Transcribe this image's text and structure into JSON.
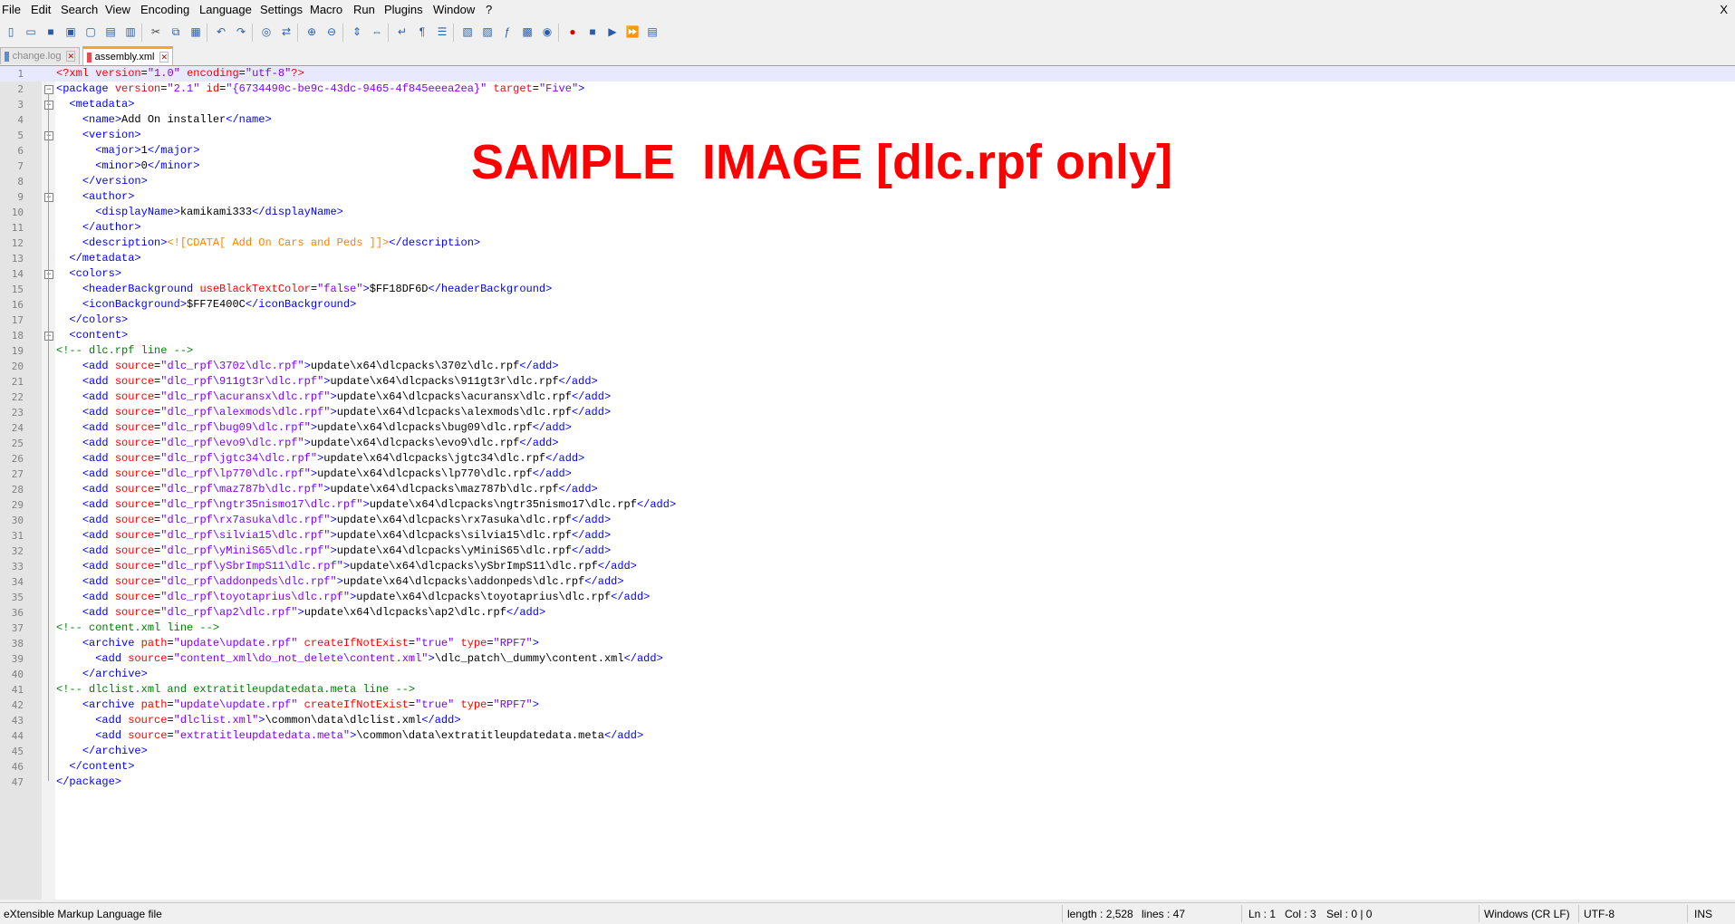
{
  "menu": {
    "items": [
      "File",
      "Edit",
      "Search",
      "View",
      "Encoding",
      "Language",
      "Settings",
      "Macro",
      "Run",
      "Plugins",
      "Window",
      "?"
    ],
    "close_label": "X"
  },
  "toolbar": {
    "icons": [
      "new-file-icon",
      "open-file-icon",
      "save-icon",
      "save-all-icon",
      "close-icon",
      "close-all-icon",
      "print-icon",
      "cut-icon",
      "copy-icon",
      "paste-icon",
      "undo-icon",
      "redo-icon",
      "find-icon",
      "replace-icon",
      "zoom-in-icon",
      "zoom-out-icon",
      "sync-vertical-icon",
      "sync-horizontal-icon",
      "word-wrap-icon",
      "show-all-chars-icon",
      "indent-guide-icon",
      "lang-define-icon",
      "doc-map-icon",
      "function-list-icon",
      "folder-workspace-icon",
      "monitoring-icon",
      "record-macro-icon",
      "stop-macro-icon",
      "play-macro-icon",
      "run-macro-multiple-icon",
      "save-macro-icon"
    ]
  },
  "tabs": [
    {
      "label": "change.log",
      "active": false
    },
    {
      "label": "assembly.xml",
      "active": true
    }
  ],
  "editor": {
    "current_line": 1,
    "lines": [
      [
        [
          "t-pi",
          "<?xml "
        ],
        [
          "t-attr",
          "version"
        ],
        [
          "t-tx",
          "="
        ],
        [
          "t-val",
          "\"1.0\""
        ],
        [
          "t-tx",
          " "
        ],
        [
          "t-attr",
          "encoding"
        ],
        [
          "t-tx",
          "="
        ],
        [
          "t-val",
          "\"utf-8\""
        ],
        [
          "t-pi",
          "?>"
        ]
      ],
      [
        [
          "t-tag",
          "<package "
        ],
        [
          "t-attr",
          "version"
        ],
        [
          "t-tx",
          "="
        ],
        [
          "t-val",
          "\"2.1\""
        ],
        [
          "t-tx",
          " "
        ],
        [
          "t-attr",
          "id"
        ],
        [
          "t-tx",
          "="
        ],
        [
          "t-val",
          "\"{6734490c-be9c-43dc-9465-4f845eeea2ea}\""
        ],
        [
          "t-tx",
          " "
        ],
        [
          "t-attr",
          "target"
        ],
        [
          "t-tx",
          "="
        ],
        [
          "t-val",
          "\"Five\""
        ],
        [
          "t-tag",
          ">"
        ]
      ],
      [
        [
          "t-tx",
          "  "
        ],
        [
          "t-tag",
          "<metadata>"
        ]
      ],
      [
        [
          "t-tx",
          "    "
        ],
        [
          "t-tag",
          "<name>"
        ],
        [
          "t-tx",
          "Add On installer"
        ],
        [
          "t-tag",
          "</name>"
        ]
      ],
      [
        [
          "t-tx",
          "    "
        ],
        [
          "t-tag",
          "<version>"
        ]
      ],
      [
        [
          "t-tx",
          "      "
        ],
        [
          "t-tag",
          "<major>"
        ],
        [
          "t-tx",
          "1"
        ],
        [
          "t-tag",
          "</major>"
        ]
      ],
      [
        [
          "t-tx",
          "      "
        ],
        [
          "t-tag",
          "<minor>"
        ],
        [
          "t-tx",
          "0"
        ],
        [
          "t-tag",
          "</minor>"
        ]
      ],
      [
        [
          "t-tx",
          "    "
        ],
        [
          "t-tag",
          "</version>"
        ]
      ],
      [
        [
          "t-tx",
          "    "
        ],
        [
          "t-tag",
          "<author>"
        ]
      ],
      [
        [
          "t-tx",
          "      "
        ],
        [
          "t-tag",
          "<displayName>"
        ],
        [
          "t-tx",
          "kamikami333"
        ],
        [
          "t-tag",
          "</displayName>"
        ]
      ],
      [
        [
          "t-tx",
          "    "
        ],
        [
          "t-tag",
          "</author>"
        ]
      ],
      [
        [
          "t-tx",
          "    "
        ],
        [
          "t-tag",
          "<description>"
        ],
        [
          "t-cd",
          "<![CDATA[ Add On Cars and Peds ]]>"
        ],
        [
          "t-tag",
          "</description>"
        ]
      ],
      [
        [
          "t-tx",
          "  "
        ],
        [
          "t-tag",
          "</metadata>"
        ]
      ],
      [
        [
          "t-tx",
          "  "
        ],
        [
          "t-tag",
          "<colors>"
        ]
      ],
      [
        [
          "t-tx",
          "    "
        ],
        [
          "t-tag",
          "<headerBackground "
        ],
        [
          "t-attr",
          "useBlackTextColor"
        ],
        [
          "t-tx",
          "="
        ],
        [
          "t-val",
          "\"false\""
        ],
        [
          "t-tag",
          ">"
        ],
        [
          "t-tx",
          "$FF18DF6D"
        ],
        [
          "t-tag",
          "</headerBackground>"
        ]
      ],
      [
        [
          "t-tx",
          "    "
        ],
        [
          "t-tag",
          "<iconBackground>"
        ],
        [
          "t-tx",
          "$FF7E400C"
        ],
        [
          "t-tag",
          "</iconBackground>"
        ]
      ],
      [
        [
          "t-tx",
          "  "
        ],
        [
          "t-tag",
          "</colors>"
        ]
      ],
      [
        [
          "t-tx",
          "  "
        ],
        [
          "t-tag",
          "<content>"
        ]
      ],
      [
        [
          "t-cm",
          "<!-- dlc.rpf line -->"
        ]
      ],
      [
        [
          "t-tx",
          "    "
        ],
        [
          "t-tag",
          "<add "
        ],
        [
          "t-attr",
          "source"
        ],
        [
          "t-tx",
          "="
        ],
        [
          "t-val",
          "\"dlc_rpf\\370z\\dlc.rpf\""
        ],
        [
          "t-tag",
          ">"
        ],
        [
          "t-tx",
          "update\\x64\\dlcpacks\\370z\\dlc.rpf"
        ],
        [
          "t-tag",
          "</add>"
        ]
      ],
      [
        [
          "t-tx",
          "    "
        ],
        [
          "t-tag",
          "<add "
        ],
        [
          "t-attr",
          "source"
        ],
        [
          "t-tx",
          "="
        ],
        [
          "t-val",
          "\"dlc_rpf\\911gt3r\\dlc.rpf\""
        ],
        [
          "t-tag",
          ">"
        ],
        [
          "t-tx",
          "update\\x64\\dlcpacks\\911gt3r\\dlc.rpf"
        ],
        [
          "t-tag",
          "</add>"
        ]
      ],
      [
        [
          "t-tx",
          "    "
        ],
        [
          "t-tag",
          "<add "
        ],
        [
          "t-attr",
          "source"
        ],
        [
          "t-tx",
          "="
        ],
        [
          "t-val",
          "\"dlc_rpf\\acuransx\\dlc.rpf\""
        ],
        [
          "t-tag",
          ">"
        ],
        [
          "t-tx",
          "update\\x64\\dlcpacks\\acuransx\\dlc.rpf"
        ],
        [
          "t-tag",
          "</add>"
        ]
      ],
      [
        [
          "t-tx",
          "    "
        ],
        [
          "t-tag",
          "<add "
        ],
        [
          "t-attr",
          "source"
        ],
        [
          "t-tx",
          "="
        ],
        [
          "t-val",
          "\"dlc_rpf\\alexmods\\dlc.rpf\""
        ],
        [
          "t-tag",
          ">"
        ],
        [
          "t-tx",
          "update\\x64\\dlcpacks\\alexmods\\dlc.rpf"
        ],
        [
          "t-tag",
          "</add>"
        ]
      ],
      [
        [
          "t-tx",
          "    "
        ],
        [
          "t-tag",
          "<add "
        ],
        [
          "t-attr",
          "source"
        ],
        [
          "t-tx",
          "="
        ],
        [
          "t-val",
          "\"dlc_rpf\\bug09\\dlc.rpf\""
        ],
        [
          "t-tag",
          ">"
        ],
        [
          "t-tx",
          "update\\x64\\dlcpacks\\bug09\\dlc.rpf"
        ],
        [
          "t-tag",
          "</add>"
        ]
      ],
      [
        [
          "t-tx",
          "    "
        ],
        [
          "t-tag",
          "<add "
        ],
        [
          "t-attr",
          "source"
        ],
        [
          "t-tx",
          "="
        ],
        [
          "t-val",
          "\"dlc_rpf\\evo9\\dlc.rpf\""
        ],
        [
          "t-tag",
          ">"
        ],
        [
          "t-tx",
          "update\\x64\\dlcpacks\\evo9\\dlc.rpf"
        ],
        [
          "t-tag",
          "</add>"
        ]
      ],
      [
        [
          "t-tx",
          "    "
        ],
        [
          "t-tag",
          "<add "
        ],
        [
          "t-attr",
          "source"
        ],
        [
          "t-tx",
          "="
        ],
        [
          "t-val",
          "\"dlc_rpf\\jgtc34\\dlc.rpf\""
        ],
        [
          "t-tag",
          ">"
        ],
        [
          "t-tx",
          "update\\x64\\dlcpacks\\jgtc34\\dlc.rpf"
        ],
        [
          "t-tag",
          "</add>"
        ]
      ],
      [
        [
          "t-tx",
          "    "
        ],
        [
          "t-tag",
          "<add "
        ],
        [
          "t-attr",
          "source"
        ],
        [
          "t-tx",
          "="
        ],
        [
          "t-val",
          "\"dlc_rpf\\lp770\\dlc.rpf\""
        ],
        [
          "t-tag",
          ">"
        ],
        [
          "t-tx",
          "update\\x64\\dlcpacks\\lp770\\dlc.rpf"
        ],
        [
          "t-tag",
          "</add>"
        ]
      ],
      [
        [
          "t-tx",
          "    "
        ],
        [
          "t-tag",
          "<add "
        ],
        [
          "t-attr",
          "source"
        ],
        [
          "t-tx",
          "="
        ],
        [
          "t-val",
          "\"dlc_rpf\\maz787b\\dlc.rpf\""
        ],
        [
          "t-tag",
          ">"
        ],
        [
          "t-tx",
          "update\\x64\\dlcpacks\\maz787b\\dlc.rpf"
        ],
        [
          "t-tag",
          "</add>"
        ]
      ],
      [
        [
          "t-tx",
          "    "
        ],
        [
          "t-tag",
          "<add "
        ],
        [
          "t-attr",
          "source"
        ],
        [
          "t-tx",
          "="
        ],
        [
          "t-val",
          "\"dlc_rpf\\ngtr35nismo17\\dlc.rpf\""
        ],
        [
          "t-tag",
          ">"
        ],
        [
          "t-tx",
          "update\\x64\\dlcpacks\\ngtr35nismo17\\dlc.rpf"
        ],
        [
          "t-tag",
          "</add>"
        ]
      ],
      [
        [
          "t-tx",
          "    "
        ],
        [
          "t-tag",
          "<add "
        ],
        [
          "t-attr",
          "source"
        ],
        [
          "t-tx",
          "="
        ],
        [
          "t-val",
          "\"dlc_rpf\\rx7asuka\\dlc.rpf\""
        ],
        [
          "t-tag",
          ">"
        ],
        [
          "t-tx",
          "update\\x64\\dlcpacks\\rx7asuka\\dlc.rpf"
        ],
        [
          "t-tag",
          "</add>"
        ]
      ],
      [
        [
          "t-tx",
          "    "
        ],
        [
          "t-tag",
          "<add "
        ],
        [
          "t-attr",
          "source"
        ],
        [
          "t-tx",
          "="
        ],
        [
          "t-val",
          "\"dlc_rpf\\silvia15\\dlc.rpf\""
        ],
        [
          "t-tag",
          ">"
        ],
        [
          "t-tx",
          "update\\x64\\dlcpacks\\silvia15\\dlc.rpf"
        ],
        [
          "t-tag",
          "</add>"
        ]
      ],
      [
        [
          "t-tx",
          "    "
        ],
        [
          "t-tag",
          "<add "
        ],
        [
          "t-attr",
          "source"
        ],
        [
          "t-tx",
          "="
        ],
        [
          "t-val",
          "\"dlc_rpf\\yMiniS65\\dlc.rpf\""
        ],
        [
          "t-tag",
          ">"
        ],
        [
          "t-tx",
          "update\\x64\\dlcpacks\\yMiniS65\\dlc.rpf"
        ],
        [
          "t-tag",
          "</add>"
        ]
      ],
      [
        [
          "t-tx",
          "    "
        ],
        [
          "t-tag",
          "<add "
        ],
        [
          "t-attr",
          "source"
        ],
        [
          "t-tx",
          "="
        ],
        [
          "t-val",
          "\"dlc_rpf\\ySbrImpS11\\dlc.rpf\""
        ],
        [
          "t-tag",
          ">"
        ],
        [
          "t-tx",
          "update\\x64\\dlcpacks\\ySbrImpS11\\dlc.rpf"
        ],
        [
          "t-tag",
          "</add>"
        ]
      ],
      [
        [
          "t-tx",
          "    "
        ],
        [
          "t-tag",
          "<add "
        ],
        [
          "t-attr",
          "source"
        ],
        [
          "t-tx",
          "="
        ],
        [
          "t-val",
          "\"dlc_rpf\\addonpeds\\dlc.rpf\""
        ],
        [
          "t-tag",
          ">"
        ],
        [
          "t-tx",
          "update\\x64\\dlcpacks\\addonpeds\\dlc.rpf"
        ],
        [
          "t-tag",
          "</add>"
        ]
      ],
      [
        [
          "t-tx",
          "    "
        ],
        [
          "t-tag",
          "<add "
        ],
        [
          "t-attr",
          "source"
        ],
        [
          "t-tx",
          "="
        ],
        [
          "t-val",
          "\"dlc_rpf\\toyotaprius\\dlc.rpf\""
        ],
        [
          "t-tag",
          ">"
        ],
        [
          "t-tx",
          "update\\x64\\dlcpacks\\toyotaprius\\dlc.rpf"
        ],
        [
          "t-tag",
          "</add>"
        ]
      ],
      [
        [
          "t-tx",
          "    "
        ],
        [
          "t-tag",
          "<add "
        ],
        [
          "t-attr",
          "source"
        ],
        [
          "t-tx",
          "="
        ],
        [
          "t-val",
          "\"dlc_rpf\\ap2\\dlc.rpf\""
        ],
        [
          "t-tag",
          ">"
        ],
        [
          "t-tx",
          "update\\x64\\dlcpacks\\ap2\\dlc.rpf"
        ],
        [
          "t-tag",
          "</add>"
        ]
      ],
      [
        [
          "t-cm",
          "<!-- content.xml line -->"
        ]
      ],
      [
        [
          "t-tx",
          "    "
        ],
        [
          "t-tag",
          "<archive "
        ],
        [
          "t-attr",
          "path"
        ],
        [
          "t-tx",
          "="
        ],
        [
          "t-val",
          "\"update\\update.rpf\""
        ],
        [
          "t-tx",
          " "
        ],
        [
          "t-attr",
          "createIfNotExist"
        ],
        [
          "t-tx",
          "="
        ],
        [
          "t-val",
          "\"true\""
        ],
        [
          "t-tx",
          " "
        ],
        [
          "t-attr",
          "type"
        ],
        [
          "t-tx",
          "="
        ],
        [
          "t-val",
          "\"RPF7\""
        ],
        [
          "t-tag",
          ">"
        ]
      ],
      [
        [
          "t-tx",
          "      "
        ],
        [
          "t-tag",
          "<add "
        ],
        [
          "t-attr",
          "source"
        ],
        [
          "t-tx",
          "="
        ],
        [
          "t-val",
          "\"content_xml\\do_not_delete\\content.xml\""
        ],
        [
          "t-tag",
          ">"
        ],
        [
          "t-tx",
          "\\dlc_patch\\_dummy\\content.xml"
        ],
        [
          "t-tag",
          "</add>"
        ]
      ],
      [
        [
          "t-tx",
          "    "
        ],
        [
          "t-tag",
          "</archive>"
        ]
      ],
      [
        [
          "t-cm",
          "<!-- dlclist.xml and extratitleupdatedata.meta line -->"
        ]
      ],
      [
        [
          "t-tx",
          "    "
        ],
        [
          "t-tag",
          "<archive "
        ],
        [
          "t-attr",
          "path"
        ],
        [
          "t-tx",
          "="
        ],
        [
          "t-val",
          "\"update\\update.rpf\""
        ],
        [
          "t-tx",
          " "
        ],
        [
          "t-attr",
          "createIfNotExist"
        ],
        [
          "t-tx",
          "="
        ],
        [
          "t-val",
          "\"true\""
        ],
        [
          "t-tx",
          " "
        ],
        [
          "t-attr",
          "type"
        ],
        [
          "t-tx",
          "="
        ],
        [
          "t-val",
          "\"RPF7\""
        ],
        [
          "t-tag",
          ">"
        ]
      ],
      [
        [
          "t-tx",
          "      "
        ],
        [
          "t-tag",
          "<add "
        ],
        [
          "t-attr",
          "source"
        ],
        [
          "t-tx",
          "="
        ],
        [
          "t-val",
          "\"dlclist.xml\""
        ],
        [
          "t-tag",
          ">"
        ],
        [
          "t-tx",
          "\\common\\data\\dlclist.xml"
        ],
        [
          "t-tag",
          "</add>"
        ]
      ],
      [
        [
          "t-tx",
          "      "
        ],
        [
          "t-tag",
          "<add "
        ],
        [
          "t-attr",
          "source"
        ],
        [
          "t-tx",
          "="
        ],
        [
          "t-val",
          "\"extratitleupdatedata.meta\""
        ],
        [
          "t-tag",
          ">"
        ],
        [
          "t-tx",
          "\\common\\data\\extratitleupdatedata.meta"
        ],
        [
          "t-tag",
          "</add>"
        ]
      ],
      [
        [
          "t-tx",
          "    "
        ],
        [
          "t-tag",
          "</archive>"
        ]
      ],
      [
        [
          "t-tx",
          "  "
        ],
        [
          "t-tag",
          "</content>"
        ]
      ],
      [
        [
          "t-tag",
          "</package>"
        ]
      ]
    ],
    "fold_markers": [
      2,
      3,
      5,
      9,
      14,
      18
    ]
  },
  "watermark": "SAMPLE  IMAGE [dlc.rpf only]",
  "status": {
    "file_type": "eXtensible Markup Language file",
    "length": "length : 2,528",
    "lines": "lines : 47",
    "ln": "Ln : 1",
    "col": "Col : 3",
    "sel": "Sel : 0 | 0",
    "eol": "Windows (CR LF)",
    "encoding": "UTF-8",
    "mode": "INS"
  }
}
